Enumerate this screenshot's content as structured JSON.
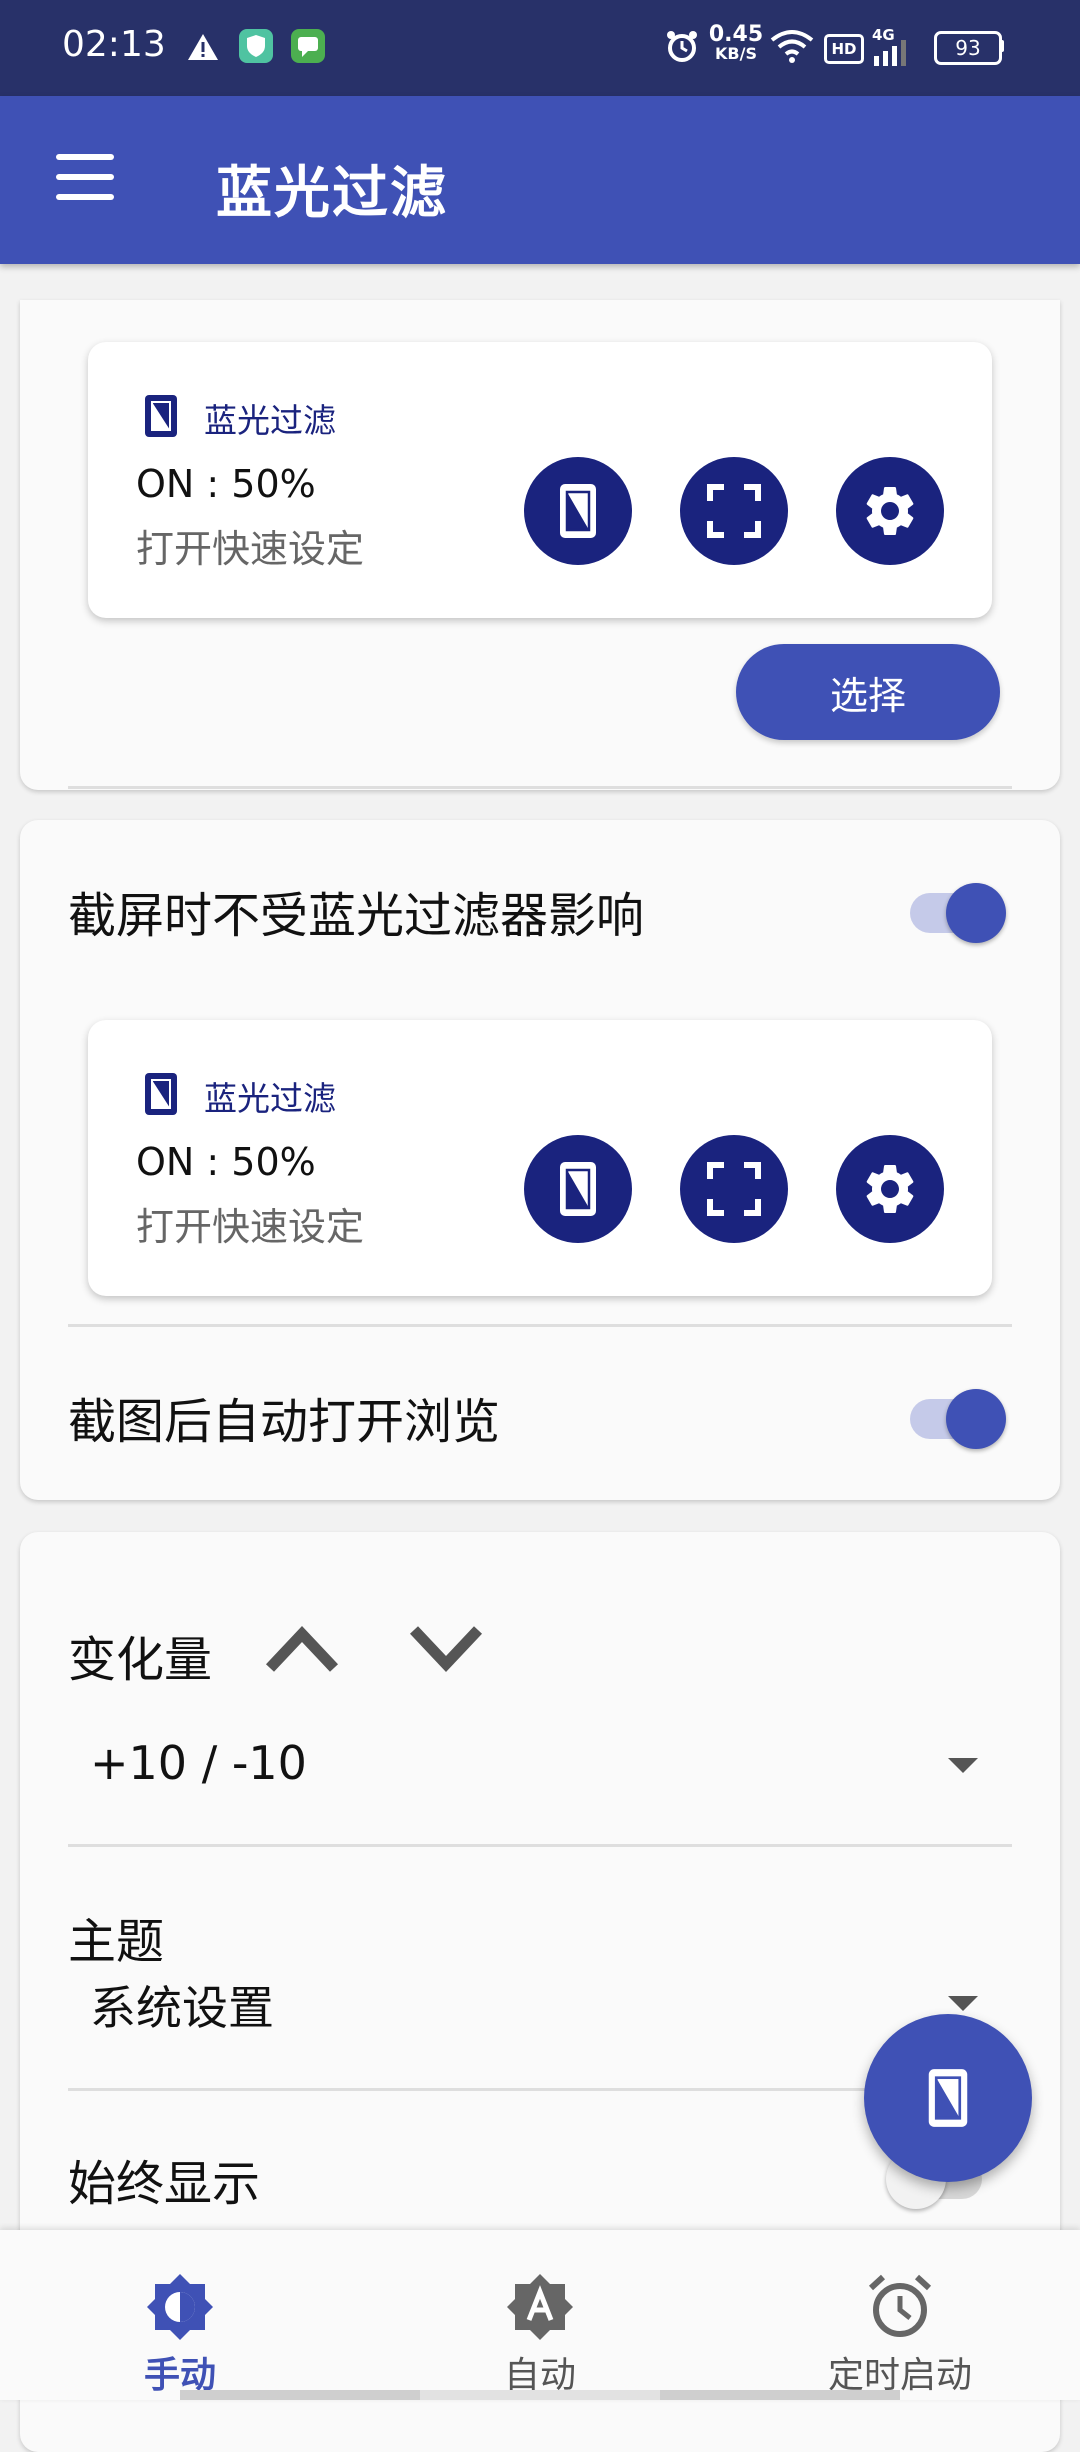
{
  "status_bar": {
    "time": "02:13",
    "speed_value": "0.45",
    "speed_unit": "KB/S",
    "hd_label": "HD",
    "network_label": "4G",
    "battery": "93"
  },
  "app_bar": {
    "title": "蓝光过滤"
  },
  "card1": {
    "preview": {
      "title": "蓝光过滤",
      "status": "ON : 50%",
      "subtitle": "打开快速设定"
    },
    "select_button": "选择"
  },
  "card2": {
    "screenshot_toggle_label": "截屏时不受蓝光过滤器影响",
    "screenshot_toggle_on": true,
    "preview": {
      "title": "蓝光过滤",
      "status": "ON : 50%",
      "subtitle": "打开快速设定"
    },
    "auto_open_label": "截图后自动打开浏览",
    "auto_open_on": true
  },
  "card3": {
    "step_label": "变化量",
    "step_value": "+10 / -10",
    "theme_label": "主题",
    "theme_value": "系统设置",
    "always_show_label": "始终显示",
    "always_show_on": false
  },
  "bottom_nav": {
    "items": [
      {
        "label": "手动",
        "icon": "brightness-half-icon",
        "active": true
      },
      {
        "label": "自动",
        "icon": "brightness-auto-icon",
        "active": false
      },
      {
        "label": "定时启动",
        "icon": "alarm-clock-icon",
        "active": false
      }
    ]
  },
  "colors": {
    "primary": "#3f51b5",
    "primary_dark": "#283169",
    "accent_dark": "#1a237e",
    "toggle_track_on": "#c5cae9"
  }
}
